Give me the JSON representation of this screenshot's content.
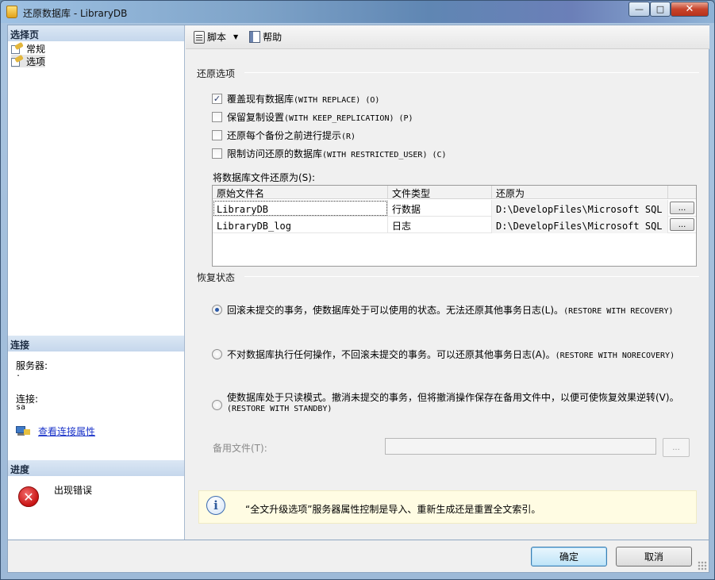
{
  "window": {
    "title": "还原数据库 - LibraryDB",
    "controls": {
      "minimize": "—",
      "maximize": "□",
      "close": "✕"
    }
  },
  "left": {
    "select_page_header": "选择页",
    "nav_items": [
      {
        "label": "常规",
        "icon": "settings-page-icon"
      },
      {
        "label": "选项",
        "icon": "settings-page-icon"
      }
    ],
    "connection_header": "连接",
    "server_label": "服务器:",
    "server_value": ".",
    "connection_label": "连接:",
    "connection_value": "sa",
    "view_connection_link": "查看连接属性",
    "progress_header": "进度",
    "progress_status": "出现错误"
  },
  "toolbar": {
    "script_label": "脚本",
    "help_label": "帮助"
  },
  "restore_options": {
    "title": "还原选项",
    "checkboxes": [
      {
        "label": "覆盖现有数据库",
        "suffix": "(WITH REPLACE) (O)",
        "checked": true
      },
      {
        "label": "保留复制设置",
        "suffix": "(WITH KEEP_REPLICATION) (P)",
        "checked": false
      },
      {
        "label": "还原每个备份之前进行提示",
        "suffix": "(R)",
        "checked": false
      },
      {
        "label": "限制访问还原的数据库",
        "suffix": "(WITH RESTRICTED_USER) (C)",
        "checked": false
      }
    ],
    "files_label": "将数据库文件还原为(S):",
    "columns": [
      "原始文件名",
      "文件类型",
      "还原为",
      ""
    ],
    "rows": [
      {
        "original": "LibraryDB",
        "type": "行数据",
        "restore_as": "D:\\DevelopFiles\\Microsoft SQL S...",
        "browse": "..."
      },
      {
        "original": "LibraryDB_log",
        "type": "日志",
        "restore_as": "D:\\DevelopFiles\\Microsoft SQL S...",
        "browse": "..."
      }
    ]
  },
  "recovery": {
    "title": "恢复状态",
    "options": [
      {
        "text": "回滚未提交的事务，使数据库处于可以使用的状态。无法还原其他事务日志(L)。",
        "suffix": "(RESTORE WITH RECOVERY)",
        "selected": true
      },
      {
        "text": "不对数据库执行任何操作，不回滚未提交的事务。可以还原其他事务日志(A)。",
        "suffix": "(RESTORE WITH NORECOVERY)",
        "selected": false
      },
      {
        "text": "使数据库处于只读模式。撤消未提交的事务，但将撤消操作保存在备用文件中，以便可使恢复效果逆转(V)。",
        "suffix": "(RESTORE WITH STANDBY)",
        "selected": false
      }
    ],
    "standby_label": "备用文件(T):",
    "standby_value": "",
    "standby_browse": "..."
  },
  "info": {
    "icon": "info-icon",
    "text": "“全文升级选项”服务器属性控制是导入、重新生成还是重置全文索引。"
  },
  "footer": {
    "ok": "确定",
    "cancel": "取消"
  }
}
